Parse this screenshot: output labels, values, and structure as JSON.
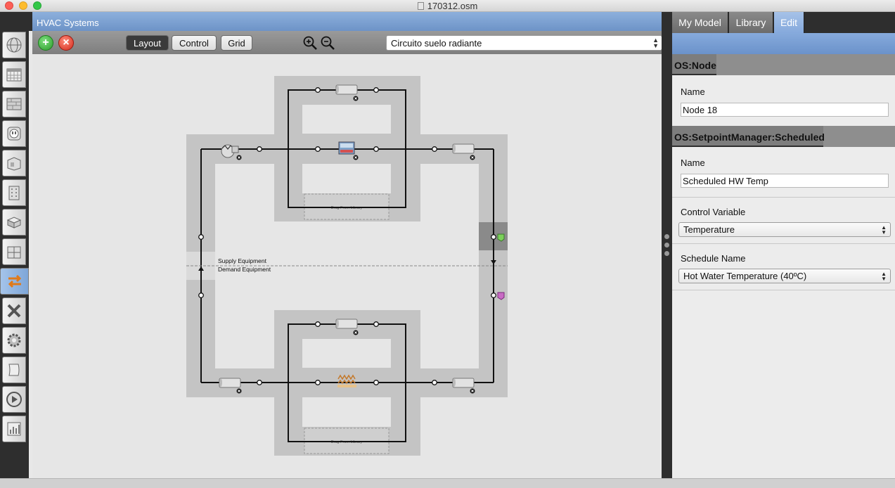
{
  "window": {
    "title": "170312.osm"
  },
  "main": {
    "section_title": "HVAC Systems",
    "toolbar": {
      "layout_label": "Layout",
      "control_label": "Control",
      "grid_label": "Grid",
      "selected_loop": "Circuito suelo radiante"
    },
    "diagram": {
      "supply_label": "Supply Equipment",
      "demand_label": "Demand Equipment",
      "drop_zone_top": "Drag From Library",
      "drop_zone_bottom": "Drag From Library"
    }
  },
  "right_panel": {
    "tabs": [
      "My Model",
      "Library",
      "Edit"
    ],
    "active_tab": "Edit",
    "node_section": {
      "header": "OS:Node",
      "name_label": "Name",
      "name_value": "Node 18"
    },
    "setpoint_section": {
      "header": "OS:SetpointManager:Scheduled",
      "name_label": "Name",
      "name_value": "Scheduled HW Temp",
      "control_variable_label": "Control Variable",
      "control_variable_value": "Temperature",
      "schedule_name_label": "Schedule Name",
      "schedule_name_value": "Hot Water Temperature (40ºC)"
    }
  },
  "colors": {
    "accent_blue": "#7ea6d8",
    "dark_chrome": "#2e2e2e",
    "loop_band": "#c4c4c4",
    "add_green": "#3cb043",
    "remove_red": "#e03a2f"
  },
  "icons": [
    "apple-close",
    "site-icon",
    "schedules-icon",
    "constructions-icon",
    "loads-icon",
    "space-types-icon",
    "facility-icon",
    "spaces-icon",
    "thermal-zones-icon",
    "hvac-icon",
    "measures-icon",
    "simulation-settings-icon",
    "scripts-icon",
    "run-icon",
    "results-icon"
  ]
}
